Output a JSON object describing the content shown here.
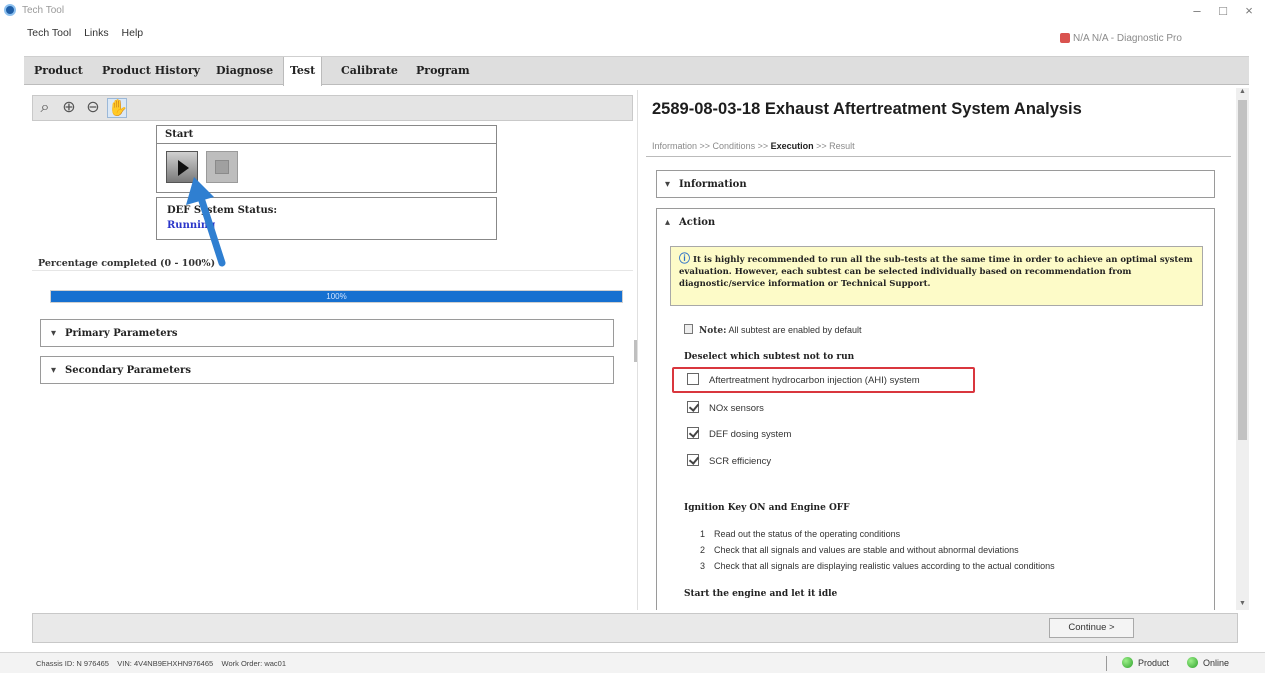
{
  "window": {
    "title": "Tech Tool",
    "user_badge": "N/A N/A - Diagnostic Pro"
  },
  "menu": [
    "Tech Tool",
    "Links",
    "Help"
  ],
  "tabs": [
    "Product",
    "Product History",
    "Diagnose",
    "Test",
    "Calibrate",
    "Program"
  ],
  "active_tab": "Test",
  "left": {
    "start_label": "Start",
    "status_label": "DEF System Status:",
    "status_value": "Running",
    "percentage_label": "Percentage completed (0 - 100%)",
    "progress": {
      "value": 100,
      "text": "100%"
    },
    "sections": [
      "Primary Parameters",
      "Secondary Parameters"
    ]
  },
  "right": {
    "title": "2589-08-03-18 Exhaust Aftertreatment System Analysis",
    "breadcrumb": {
      "a": "Information",
      "b": "Conditions",
      "c": "Execution",
      "d": "Result",
      "sep": " >> "
    },
    "info_section": "Information",
    "action_section": "Action",
    "note_text": "It is highly recommended to run all the sub-tests at the same time in order to achieve an optimal system evaluation. However, each subtest can be selected individually based on recommendation from diagnostic/service information or Technical Support.",
    "note_line_bold": "Note:",
    "note_line_text": " All subtest are enabled by default",
    "deselect_label": "Deselect which subtest not to run",
    "checkboxes": [
      {
        "label": "Aftertreatment hydrocarbon injection (AHI) system",
        "checked": false
      },
      {
        "label": "NOx sensors",
        "checked": true
      },
      {
        "label": "DEF dosing system",
        "checked": true
      },
      {
        "label": "SCR efficiency",
        "checked": true
      }
    ],
    "ignition_label": "Ignition Key ON and Engine OFF",
    "steps": [
      {
        "num": "1",
        "text": "Read out the status of the operating conditions"
      },
      {
        "num": "2",
        "text": "Check that all signals and values are stable and without abnormal deviations"
      },
      {
        "num": "3",
        "text": "Check that all signals are displaying realistic values according to the actual conditions"
      }
    ],
    "start_engine_label": "Start the engine and let it idle"
  },
  "bottom": {
    "continue_label": "Continue >"
  },
  "statusbar": {
    "chassis": "Chassis ID: N 976465",
    "vin": "VIN: 4V4NB9EHXHN976465",
    "work_order": "Work Order: wac01",
    "product": "Product",
    "online": "Online"
  },
  "colors": {
    "accent": "#1670d0",
    "highlight": "#d9363e",
    "note_bg": "#fdfbc8",
    "status_running": "#2a35c9"
  }
}
